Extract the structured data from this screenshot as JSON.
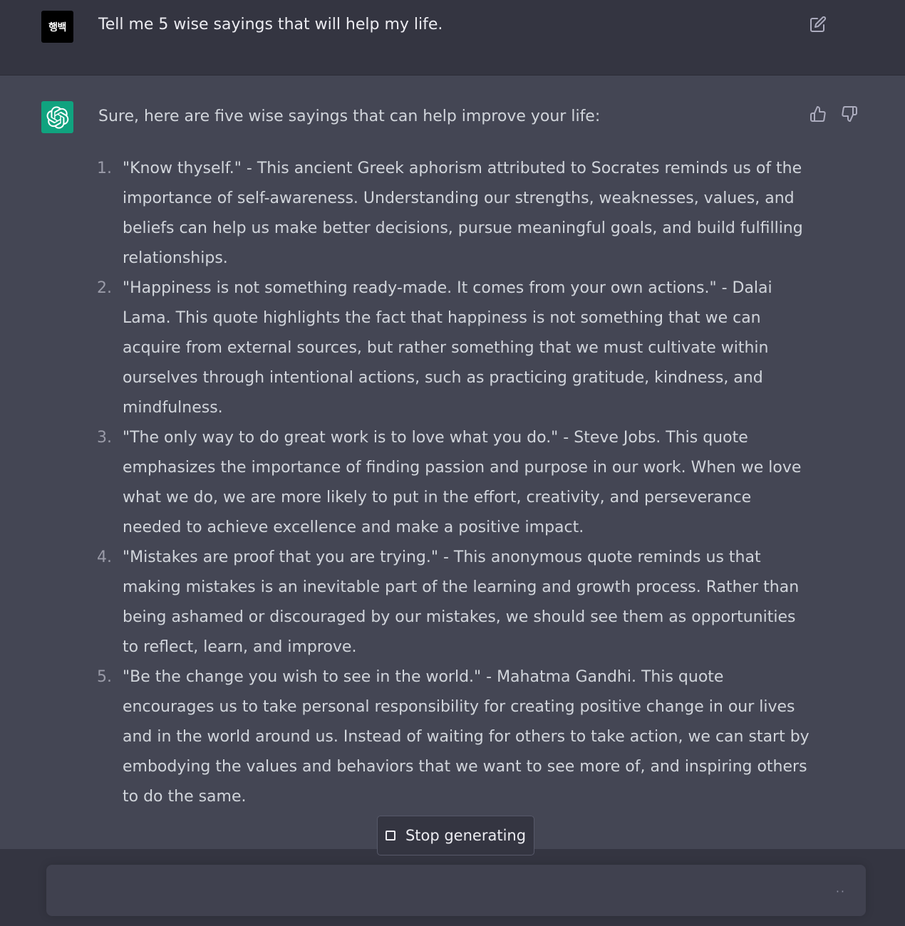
{
  "user_message": {
    "avatar_text": "행백",
    "text": "Tell me 5 wise sayings that will help my life."
  },
  "assistant_message": {
    "intro": "Sure, here are five wise sayings that can help improve your life:",
    "items": [
      {
        "num": "1.",
        "text": "\"Know thyself.\" - This ancient Greek aphorism attributed to Socrates reminds us of the importance of self-awareness. Understanding our strengths, weaknesses, values, and beliefs can help us make better decisions, pursue meaningful goals, and build fulfilling relationships."
      },
      {
        "num": "2.",
        "text": "\"Happiness is not something ready-made. It comes from your own actions.\" - Dalai Lama. This quote highlights the fact that happiness is not something that we can acquire from external sources, but rather something that we must cultivate within ourselves through intentional actions, such as practicing gratitude, kindness, and mindfulness."
      },
      {
        "num": "3.",
        "text": "\"The only way to do great work is to love what you do.\" - Steve Jobs. This quote emphasizes the importance of finding passion and purpose in our work. When we love what we do, we are more likely to put in the effort, creativity, and perseverance needed to achieve excellence and make a positive impact."
      },
      {
        "num": "4.",
        "text": "\"Mistakes are proof that you are trying.\" - This anonymous quote reminds us that making mistakes is an inevitable part of the learning and growth process. Rather than being ashamed or discouraged by our mistakes, we should see them as opportunities to reflect, learn, and improve."
      },
      {
        "num": "5.",
        "text": "\"Be the change you wish to see in the world.\" - Mahatma Gandhi. This quote encourages us to take personal responsibility for creating positive change in our lives and in the world around us. Instead of waiting for others to take action, we can start by embodying the values and behaviors that we want to see more of, and inspiring others to do the same."
      }
    ]
  },
  "controls": {
    "stop_label": "Stop generating",
    "input_value": "",
    "input_status": "··"
  },
  "colors": {
    "accent": "#10a37f",
    "background": "#343541",
    "assistant_background": "#444654"
  }
}
